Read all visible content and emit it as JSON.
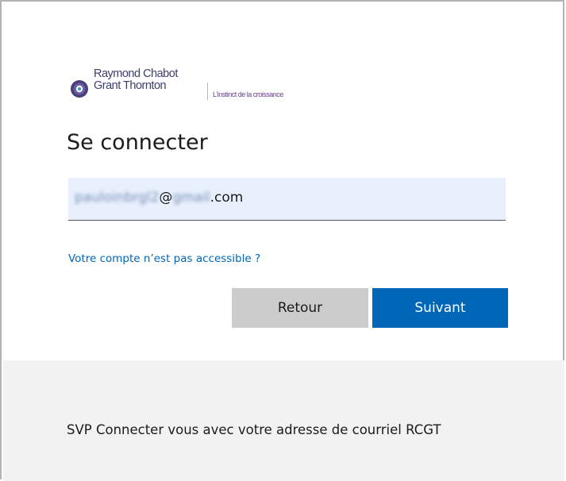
{
  "logo": {
    "name_line1": "Raymond Chabot",
    "name_line2": "Grant Thornton",
    "tagline": "L'instinct de la croissance"
  },
  "form": {
    "title": "Se connecter",
    "email": {
      "blurred_user": "pauloinbrgl2",
      "at": "@",
      "blurred_domain": "gmail",
      "suffix": ".com"
    },
    "link": "Votre compte n’est pas accessible ?",
    "back_label": "Retour",
    "next_label": "Suivant"
  },
  "footer": {
    "text": "SVP Connecter vous avec votre adresse de courriel RCGT"
  },
  "colors": {
    "primary": "#0067b8",
    "secondary_button": "#cccccc",
    "footer_bg": "#f2f2f2",
    "field_bg": "#e8f0fe"
  },
  "icons": {
    "brand": "rcgt-logo-icon"
  }
}
